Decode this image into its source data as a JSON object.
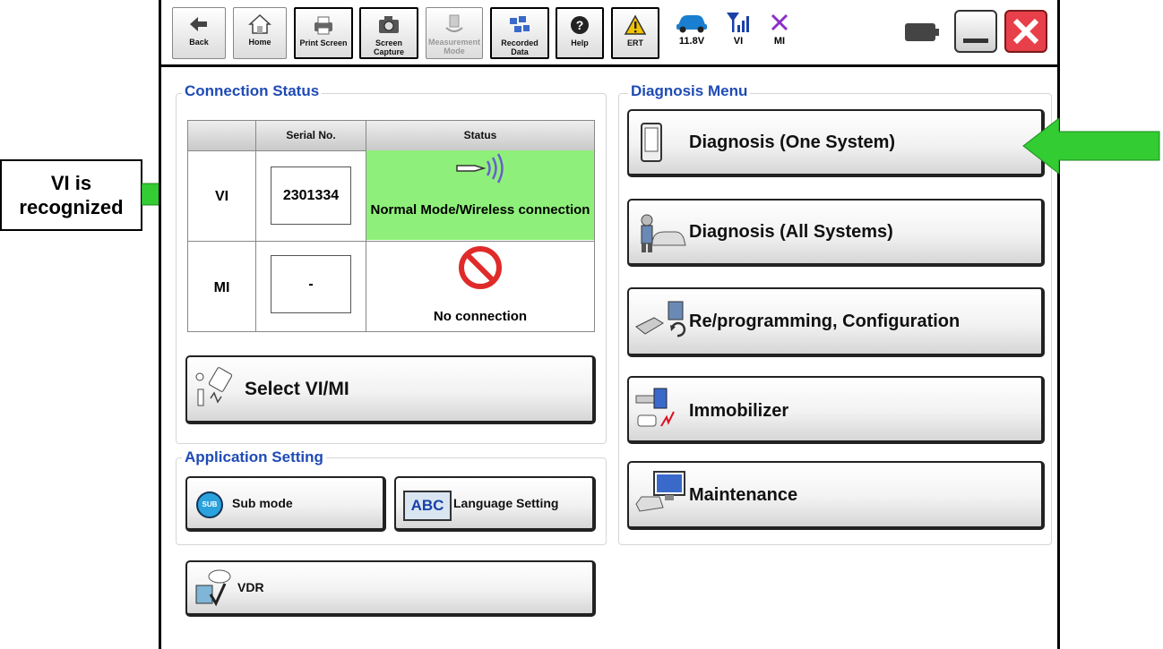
{
  "toolbar": {
    "back": "Back",
    "home": "Home",
    "print_screen": "Print Screen",
    "screen_capture": "Screen Capture",
    "measurement_mode": "Measurement Mode",
    "recorded_data": "Recorded Data",
    "help": "Help",
    "ert": "ERT",
    "battery_voltage": "11.8V",
    "vi_indicator": "VI",
    "mi_indicator": "MI"
  },
  "connection_status": {
    "title": "Connection Status",
    "headers": [
      "Serial No.",
      "Status"
    ],
    "rows": [
      {
        "label": "VI",
        "serial": "2301334",
        "status": "Normal Mode/Wireless connection"
      },
      {
        "label": "MI",
        "serial": "-",
        "status": "No connection"
      }
    ],
    "select_button": "Select VI/MI"
  },
  "application_setting": {
    "title": "Application Setting",
    "sub_mode": "Sub mode",
    "sub_icon_text": "SUB",
    "language_setting": "Language Setting",
    "abc_icon_text": "ABC"
  },
  "vdr_button": "VDR",
  "diagnosis_menu": {
    "title": "Diagnosis Menu",
    "items": [
      "Diagnosis (One System)",
      "Diagnosis (All Systems)",
      "Re/programming, Configuration",
      "Immobilizer",
      "Maintenance"
    ]
  },
  "annotation": {
    "line1": "VI is",
    "line2": "recognized"
  },
  "colors": {
    "panel_title": "#1f4bb5",
    "status_ok": "#8ef07a",
    "arrow": "#33cc33",
    "close_red": "#e8404a"
  }
}
